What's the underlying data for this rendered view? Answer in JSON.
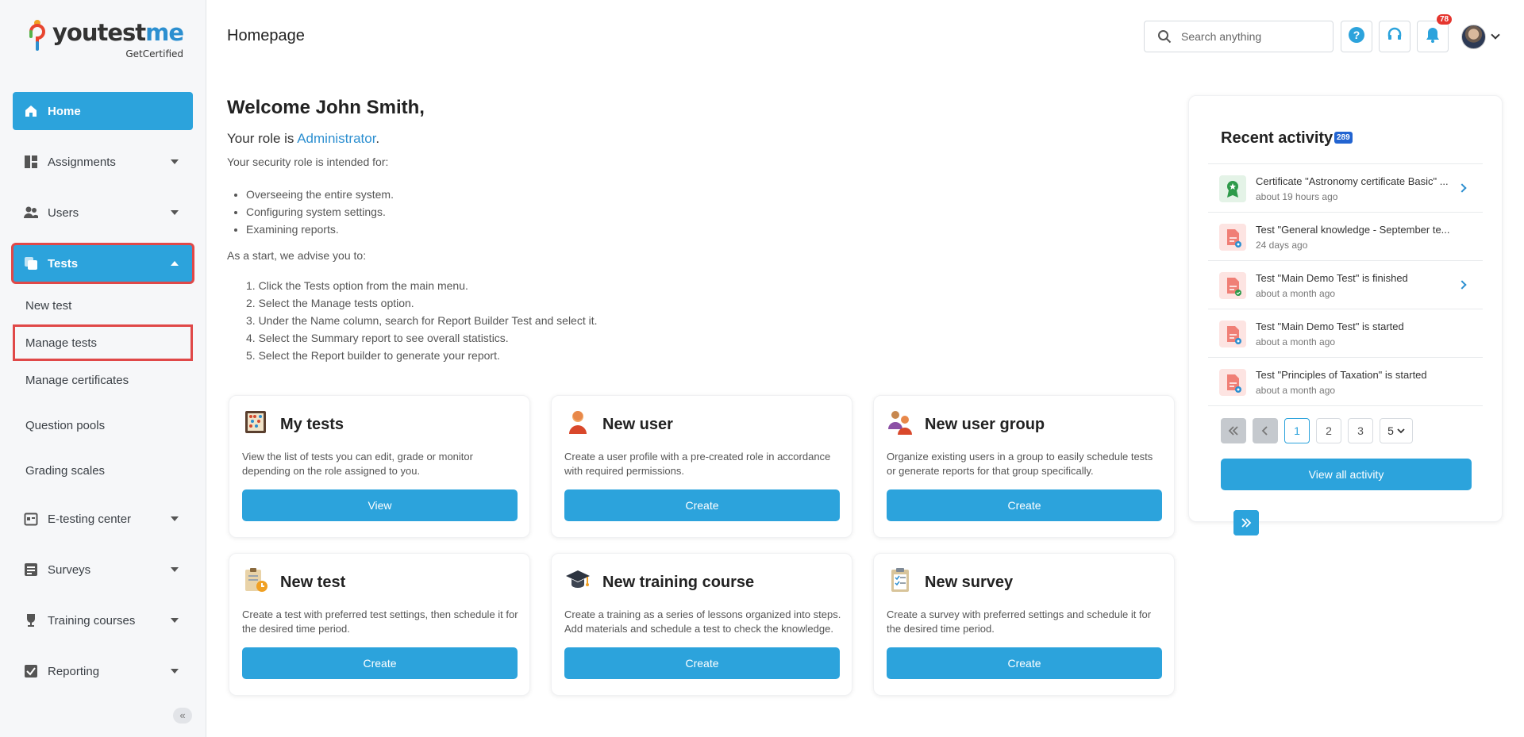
{
  "brand": {
    "name_part1": "youtest",
    "name_part2": "me",
    "sub": "GetCertified"
  },
  "header": {
    "title": "Homepage",
    "search_placeholder": "Search anything",
    "notification_count": "78"
  },
  "sidebar": {
    "items": [
      {
        "label": "Home"
      },
      {
        "label": "Assignments"
      },
      {
        "label": "Users"
      },
      {
        "label": "Tests"
      },
      {
        "label": "E-testing center"
      },
      {
        "label": "Surveys"
      },
      {
        "label": "Training courses"
      },
      {
        "label": "Reporting"
      }
    ],
    "tests_sub": [
      "New test",
      "Manage tests",
      "Manage certificates",
      "Question pools",
      "Grading scales"
    ],
    "collapse": "«"
  },
  "welcome": {
    "heading": "Welcome John Smith,",
    "role_prefix": "Your role is ",
    "role": "Administrator",
    "role_suffix": ".",
    "intro": "Your security role is intended for:",
    "bullets": [
      "Overseeing the entire system.",
      "Configuring system settings.",
      "Examining reports."
    ],
    "advise": "As a start, we advise you to:",
    "steps": [
      "1. Click the Tests option from the main menu.",
      "2. Select the Manage tests option.",
      "3. Under the Name column, search for Report Builder Test and select it.",
      "4. Select the Summary report to see overall statistics.",
      "5. Select the Report builder to generate your report."
    ]
  },
  "cards": [
    {
      "title": "My tests",
      "desc": "View the list of tests you can edit, grade or monitor depending on the role assigned to you.",
      "button": "View"
    },
    {
      "title": "New user",
      "desc": "Create a user profile with a pre-created role in accordance with required permissions.",
      "button": "Create"
    },
    {
      "title": "New user group",
      "desc": "Organize existing users in a group to easily schedule tests or generate reports for that group specifically.",
      "button": "Create"
    },
    {
      "title": "New test",
      "desc": "Create a test with preferred test settings, then schedule it for the desired time period.",
      "button": "Create"
    },
    {
      "title": "New training course",
      "desc": "Create a training as a series of lessons organized into steps. Add materials and schedule a test to check the knowledge.",
      "button": "Create"
    },
    {
      "title": "New survey",
      "desc": "Create a survey with preferred settings and schedule it for the desired time period.",
      "button": "Create"
    }
  ],
  "recent": {
    "title": "Recent activity",
    "count": "289",
    "items": [
      {
        "text": "Certificate \"Astronomy certificate Basic\" ...",
        "time": "about 19 hours ago"
      },
      {
        "text": "Test \"General knowledge - September te...",
        "time": "24 days ago"
      },
      {
        "text": "Test \"Main Demo Test\" is finished",
        "time": "about a month ago"
      },
      {
        "text": "Test \"Main Demo Test\" is started",
        "time": "about a month ago"
      },
      {
        "text": "Test \"Principles of Taxation\" is started",
        "time": "about a month ago"
      }
    ],
    "pages": [
      "1",
      "2",
      "3"
    ],
    "page_size": "5",
    "view_all": "View all activity"
  },
  "colors": {
    "accent": "#2ca3dc",
    "highlight": "#e04848",
    "link": "#2c8fd0"
  }
}
